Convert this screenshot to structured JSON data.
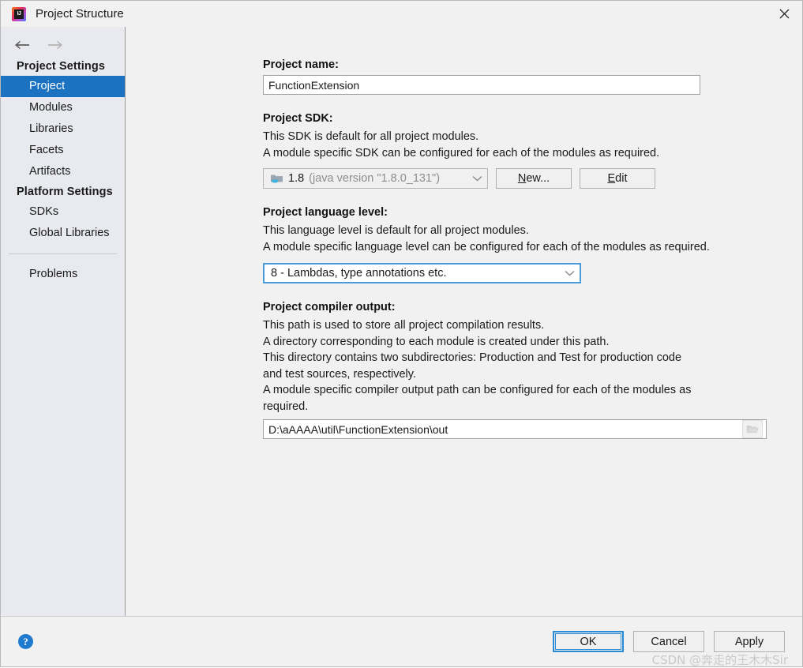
{
  "window": {
    "title": "Project Structure",
    "app_icon": "intellij-idea-icon",
    "close_label": "✕"
  },
  "sidebar": {
    "nav": {
      "back": "back-arrow",
      "forward": "forward-arrow"
    },
    "groups": [
      {
        "header": "Project Settings",
        "items": [
          {
            "label": "Project",
            "selected": true
          },
          {
            "label": "Modules",
            "selected": false
          },
          {
            "label": "Libraries",
            "selected": false
          },
          {
            "label": "Facets",
            "selected": false
          },
          {
            "label": "Artifacts",
            "selected": false
          }
        ]
      },
      {
        "header": "Platform Settings",
        "items": [
          {
            "label": "SDKs",
            "selected": false
          },
          {
            "label": "Global Libraries",
            "selected": false
          }
        ]
      }
    ],
    "problems": "Problems"
  },
  "main": {
    "project_name": {
      "label": "Project name:",
      "value": "FunctionExtension"
    },
    "project_sdk": {
      "label": "Project SDK:",
      "desc_line1": "This SDK is default for all project modules.",
      "desc_line2": "A module specific SDK can be configured for each of the modules as required.",
      "selected_version": "1.8",
      "selected_detail": "(java version \"1.8.0_131\")",
      "new_button": {
        "mnemonic": "N",
        "rest": "ew..."
      },
      "edit_button": {
        "mnemonic": "E",
        "rest": "dit"
      }
    },
    "language_level": {
      "label": "Project language level:",
      "desc_line1": "This language level is default for all project modules.",
      "desc_line2": "A module specific language level can be configured for each of the modules as required.",
      "selected": "8 - Lambdas, type annotations etc."
    },
    "compiler_output": {
      "label": "Project compiler output:",
      "desc_line1": "This path is used to store all project compilation results.",
      "desc_line2": "A directory corresponding to each module is created under this path.",
      "desc_line3": "This directory contains two subdirectories: Production and Test for production code",
      "desc_line4": "and test sources, respectively.",
      "desc_line5": "A module specific compiler output path can be configured for each of the modules as",
      "desc_line6": "required.",
      "value": "D:\\aAAAA\\util\\FunctionExtension\\out"
    }
  },
  "footer": {
    "help": "?",
    "ok": "OK",
    "cancel": "Cancel",
    "apply": "Apply",
    "watermark": "CSDN @奔走的王木木Sir"
  },
  "colors": {
    "selection_blue": "#1a72c0",
    "focus_blue": "#2a8ad4",
    "sidebar_bg": "#e8eaef",
    "panel_bg": "#f1f1f1"
  }
}
